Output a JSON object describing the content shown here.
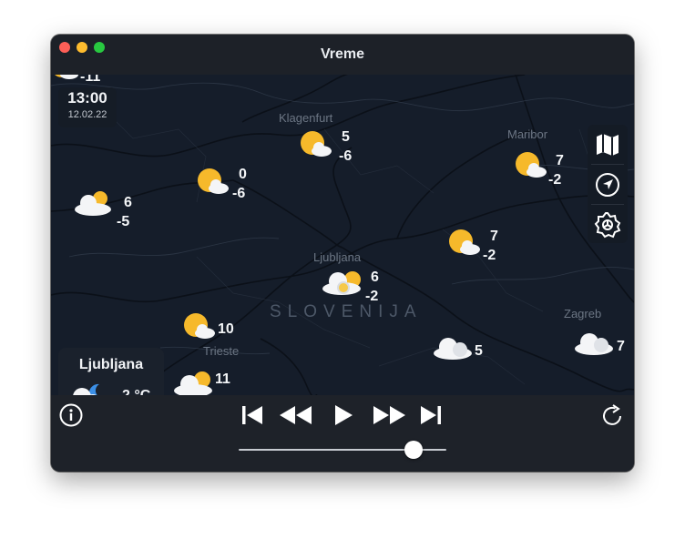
{
  "window": {
    "title": "Vreme"
  },
  "map": {
    "country_label": "SLOVENIJA",
    "cities": {
      "klagenfurt": "Klagenfurt",
      "maribor": "Maribor",
      "ljubljana": "Ljubljana",
      "trieste": "Trieste",
      "zagreb": "Zagreb"
    },
    "time": "13:00",
    "date": "12.02.22",
    "stations": [
      {
        "id": "top-left-edge",
        "icon": "sun-cloud",
        "high": "",
        "low": "-11"
      },
      {
        "id": "klagenfurt",
        "icon": "sun-cloud",
        "high": "5",
        "low": "-6"
      },
      {
        "id": "upper-left",
        "icon": "sun-cloud",
        "high": "0",
        "low": "-6"
      },
      {
        "id": "far-left",
        "icon": "cloud-sun",
        "high": "6",
        "low": "-5"
      },
      {
        "id": "maribor",
        "icon": "sun-cloud",
        "high": "7",
        "low": "-2"
      },
      {
        "id": "celje",
        "icon": "sun-cloud",
        "high": "7",
        "low": "-2"
      },
      {
        "id": "ljubljana",
        "icon": "cloud-sun",
        "high": "6",
        "low": "-2"
      },
      {
        "id": "nova-gorica",
        "icon": "sun-cloud",
        "high": "10",
        "low": ""
      },
      {
        "id": "novo-mesto",
        "icon": "cloud",
        "high": "5",
        "low": ""
      },
      {
        "id": "zagreb",
        "icon": "cloud",
        "high": "7",
        "low": ""
      },
      {
        "id": "koper",
        "icon": "cloud-sun",
        "high": "11",
        "low": ""
      }
    ],
    "current": {
      "city": "Ljubljana",
      "temperature": "2 °C",
      "icon": "cloud-moon"
    }
  },
  "sidebar": {
    "icons": [
      "map-icon",
      "location-arrow-icon",
      "gear-icon"
    ]
  },
  "playback": {
    "progress": 0.84
  },
  "colors": {
    "sun": "#f6b92b",
    "cloud": "#f4f5f7",
    "background": "#151d2a",
    "accent": "#ffffff"
  }
}
